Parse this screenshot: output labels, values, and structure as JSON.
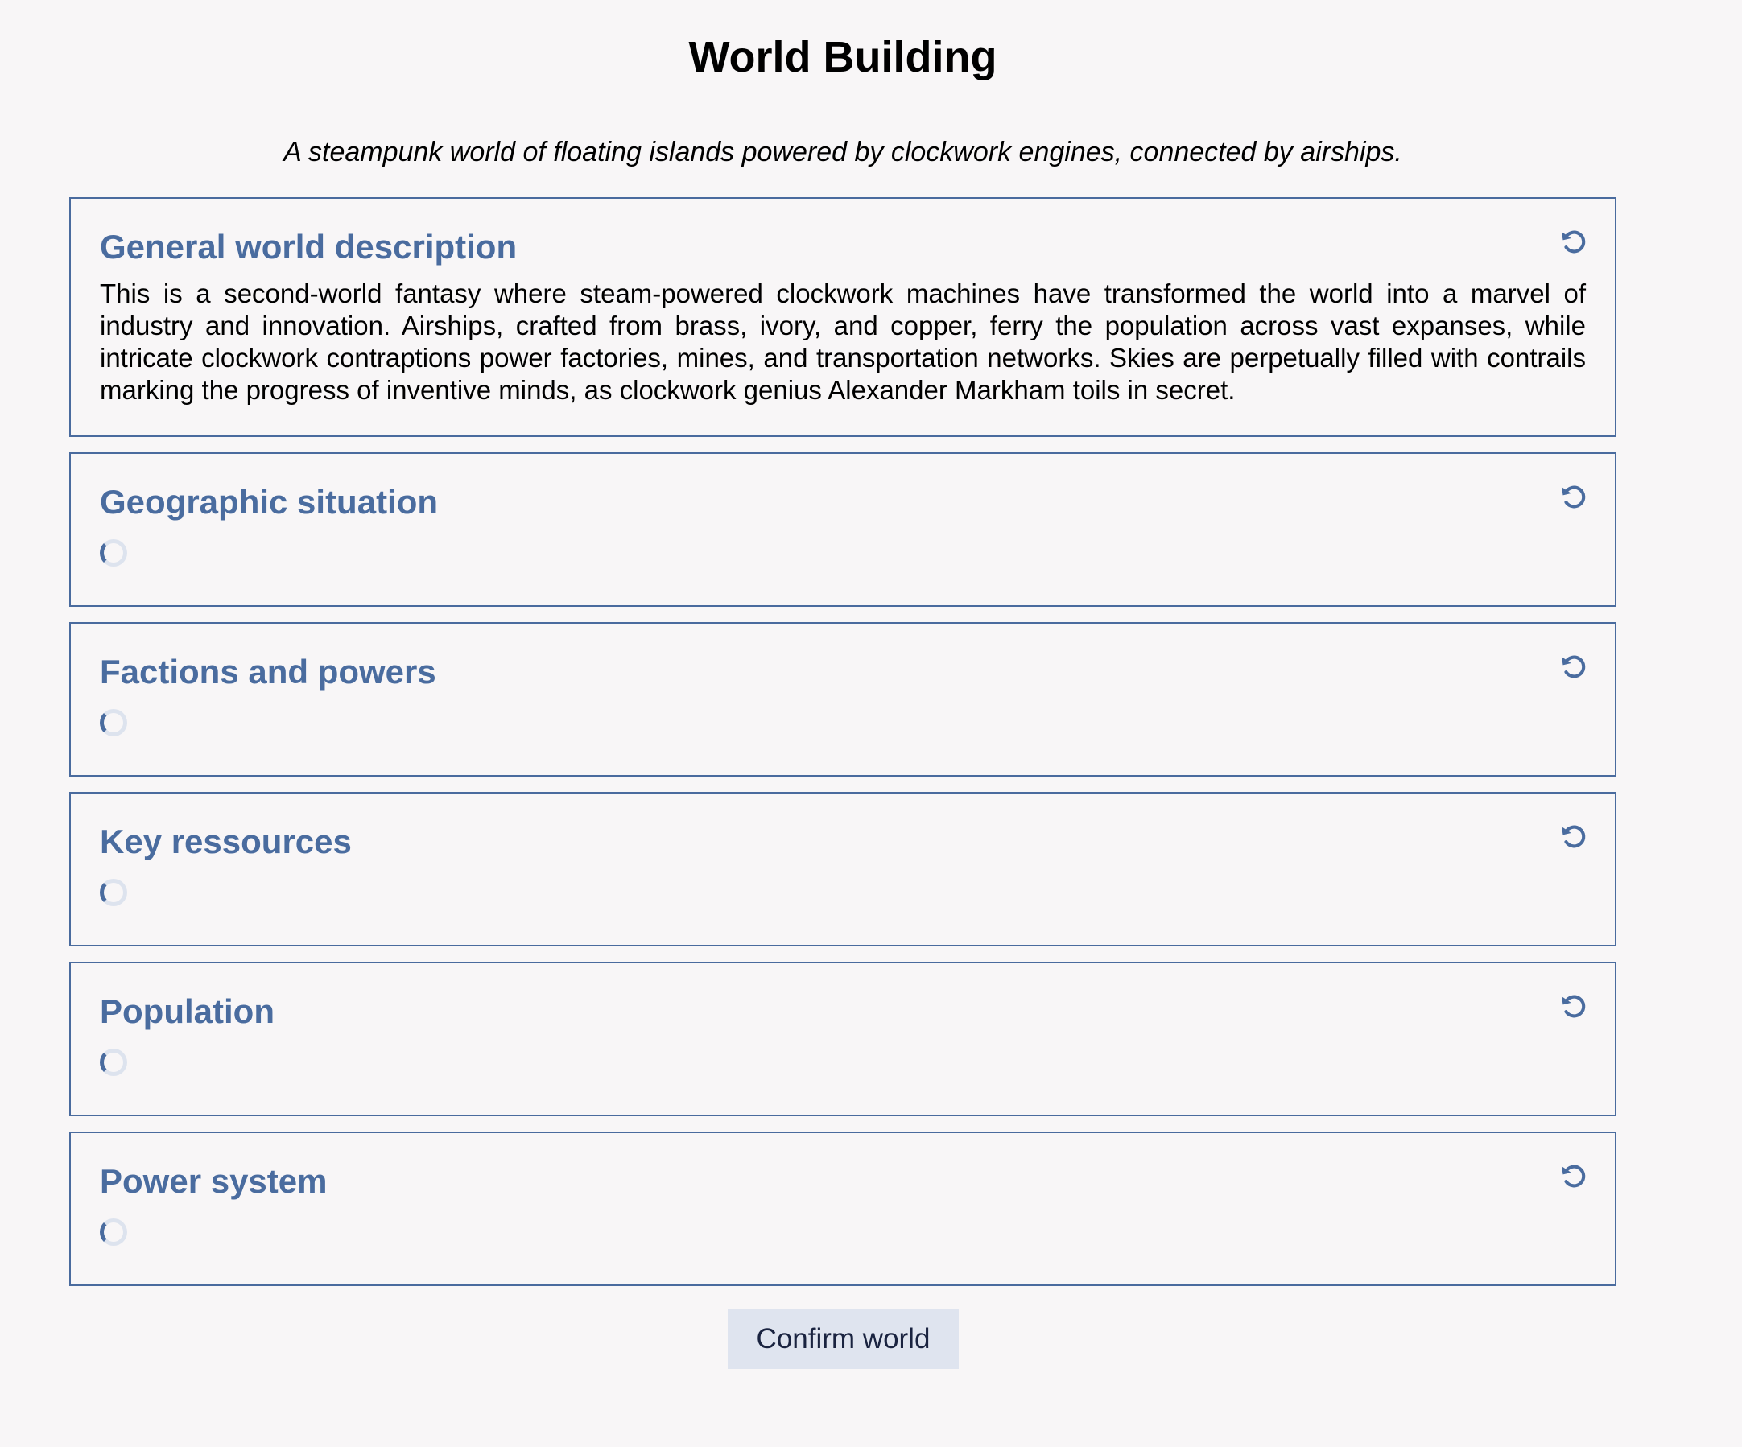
{
  "page": {
    "title": "World Building",
    "subtitle": "A steampunk world of floating islands powered by clockwork engines, connected by airships."
  },
  "sections": [
    {
      "title": "General world description",
      "text": "This is a second-world fantasy where steam-powered clockwork machines have transformed the world into a marvel of industry and innovation. Airships, crafted from brass, ivory, and copper, ferry the population across vast expanses, while intricate clockwork contraptions power factories, mines, and transportation networks. Skies are perpetually filled with contrails marking the progress of inventive minds, as clockwork genius Alexander Markham toils in secret.",
      "state": "loaded",
      "icon": "refresh-icon"
    },
    {
      "title": "Geographic situation",
      "state": "loading",
      "icon": "refresh-icon"
    },
    {
      "title": "Factions and powers",
      "state": "loading",
      "icon": "refresh-icon"
    },
    {
      "title": "Key ressources",
      "state": "loading",
      "icon": "refresh-icon"
    },
    {
      "title": "Population",
      "state": "loading",
      "icon": "refresh-icon"
    },
    {
      "title": "Power system",
      "state": "loading",
      "icon": "refresh-icon"
    }
  ],
  "actions": {
    "confirm_label": "Confirm world"
  },
  "colors": {
    "accent": "#4a6c9f",
    "border": "#4a6b9e",
    "background": "#f8f6f7",
    "button_bg": "#dfe4ef"
  }
}
